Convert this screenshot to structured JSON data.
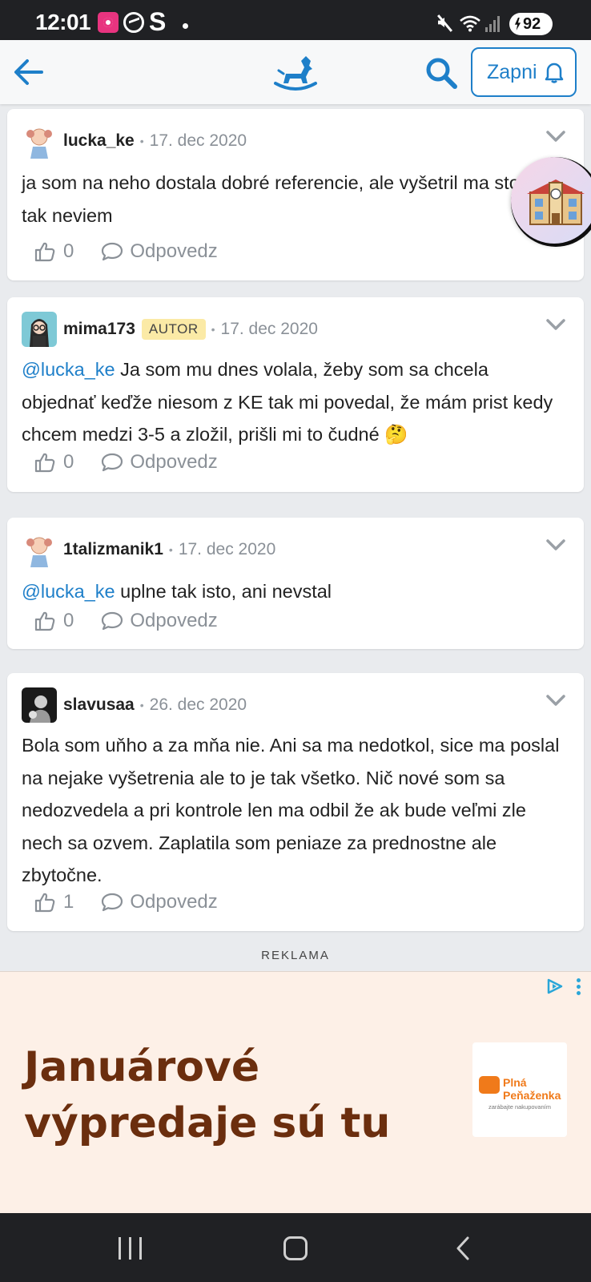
{
  "status_bar": {
    "time": "12:01",
    "battery": "92"
  },
  "app_bar": {
    "notify_label": "Zapni"
  },
  "comments": [
    {
      "author": "lucka_ke",
      "badge": "",
      "date": "17. dec 2020",
      "mention": "",
      "text": "ja som na neho dostala dobré referencie, ale vyšetril ma stola... tak neviem",
      "likes": "0",
      "reply_label": "Odpovedz"
    },
    {
      "author": "mima173",
      "badge": "AUTOR",
      "date": "17. dec 2020",
      "mention": "@lucka_ke",
      "text": "Ja som mu dnes volala, žeby som sa chcela objednať keďže niesom z KE tak mi povedal, že mám prist kedy chcem medzi 3-5 a zložil, prišli mi to čudné 🤔",
      "likes": "0",
      "reply_label": "Odpovedz"
    },
    {
      "author": "1talizmanik1",
      "badge": "",
      "date": "17. dec 2020",
      "mention": "@lucka_ke",
      "text": "uplne tak isto, ani nevstal",
      "likes": "0",
      "reply_label": "Odpovedz"
    },
    {
      "author": "slavusaa",
      "badge": "",
      "date": "26. dec 2020",
      "mention": "",
      "text": "Bola som uňho a za mňa nie. Ani sa ma nedotkol, sice ma poslal na nejake vyšetrenia ale to je tak všetko. Nič nové som sa nedozvedela a pri kontrole len ma odbil že ak bude veľmi zle nech sa ozvem. Zaplatila som peniaze za prednostne ale zbytočne.",
      "likes": "1",
      "reply_label": "Odpovedz"
    }
  ],
  "floating_button": {
    "icon": "school-building-icon",
    "emoji": "🏫"
  },
  "ad": {
    "section_label": "REKLAMA",
    "headline_line1": "Januárové",
    "headline_line2": "výpredaje sú tu",
    "brand_line1": "Plná",
    "brand_line2": "Peňaženka",
    "brand_tagline": "zarábajte nakupovaním"
  },
  "colors": {
    "accent": "#1e7fc9",
    "badge_bg": "#fbeaa6",
    "ad_bg": "#fdf0e7",
    "ad_text": "#6b2e0e",
    "brand_orange": "#f07a1a"
  }
}
